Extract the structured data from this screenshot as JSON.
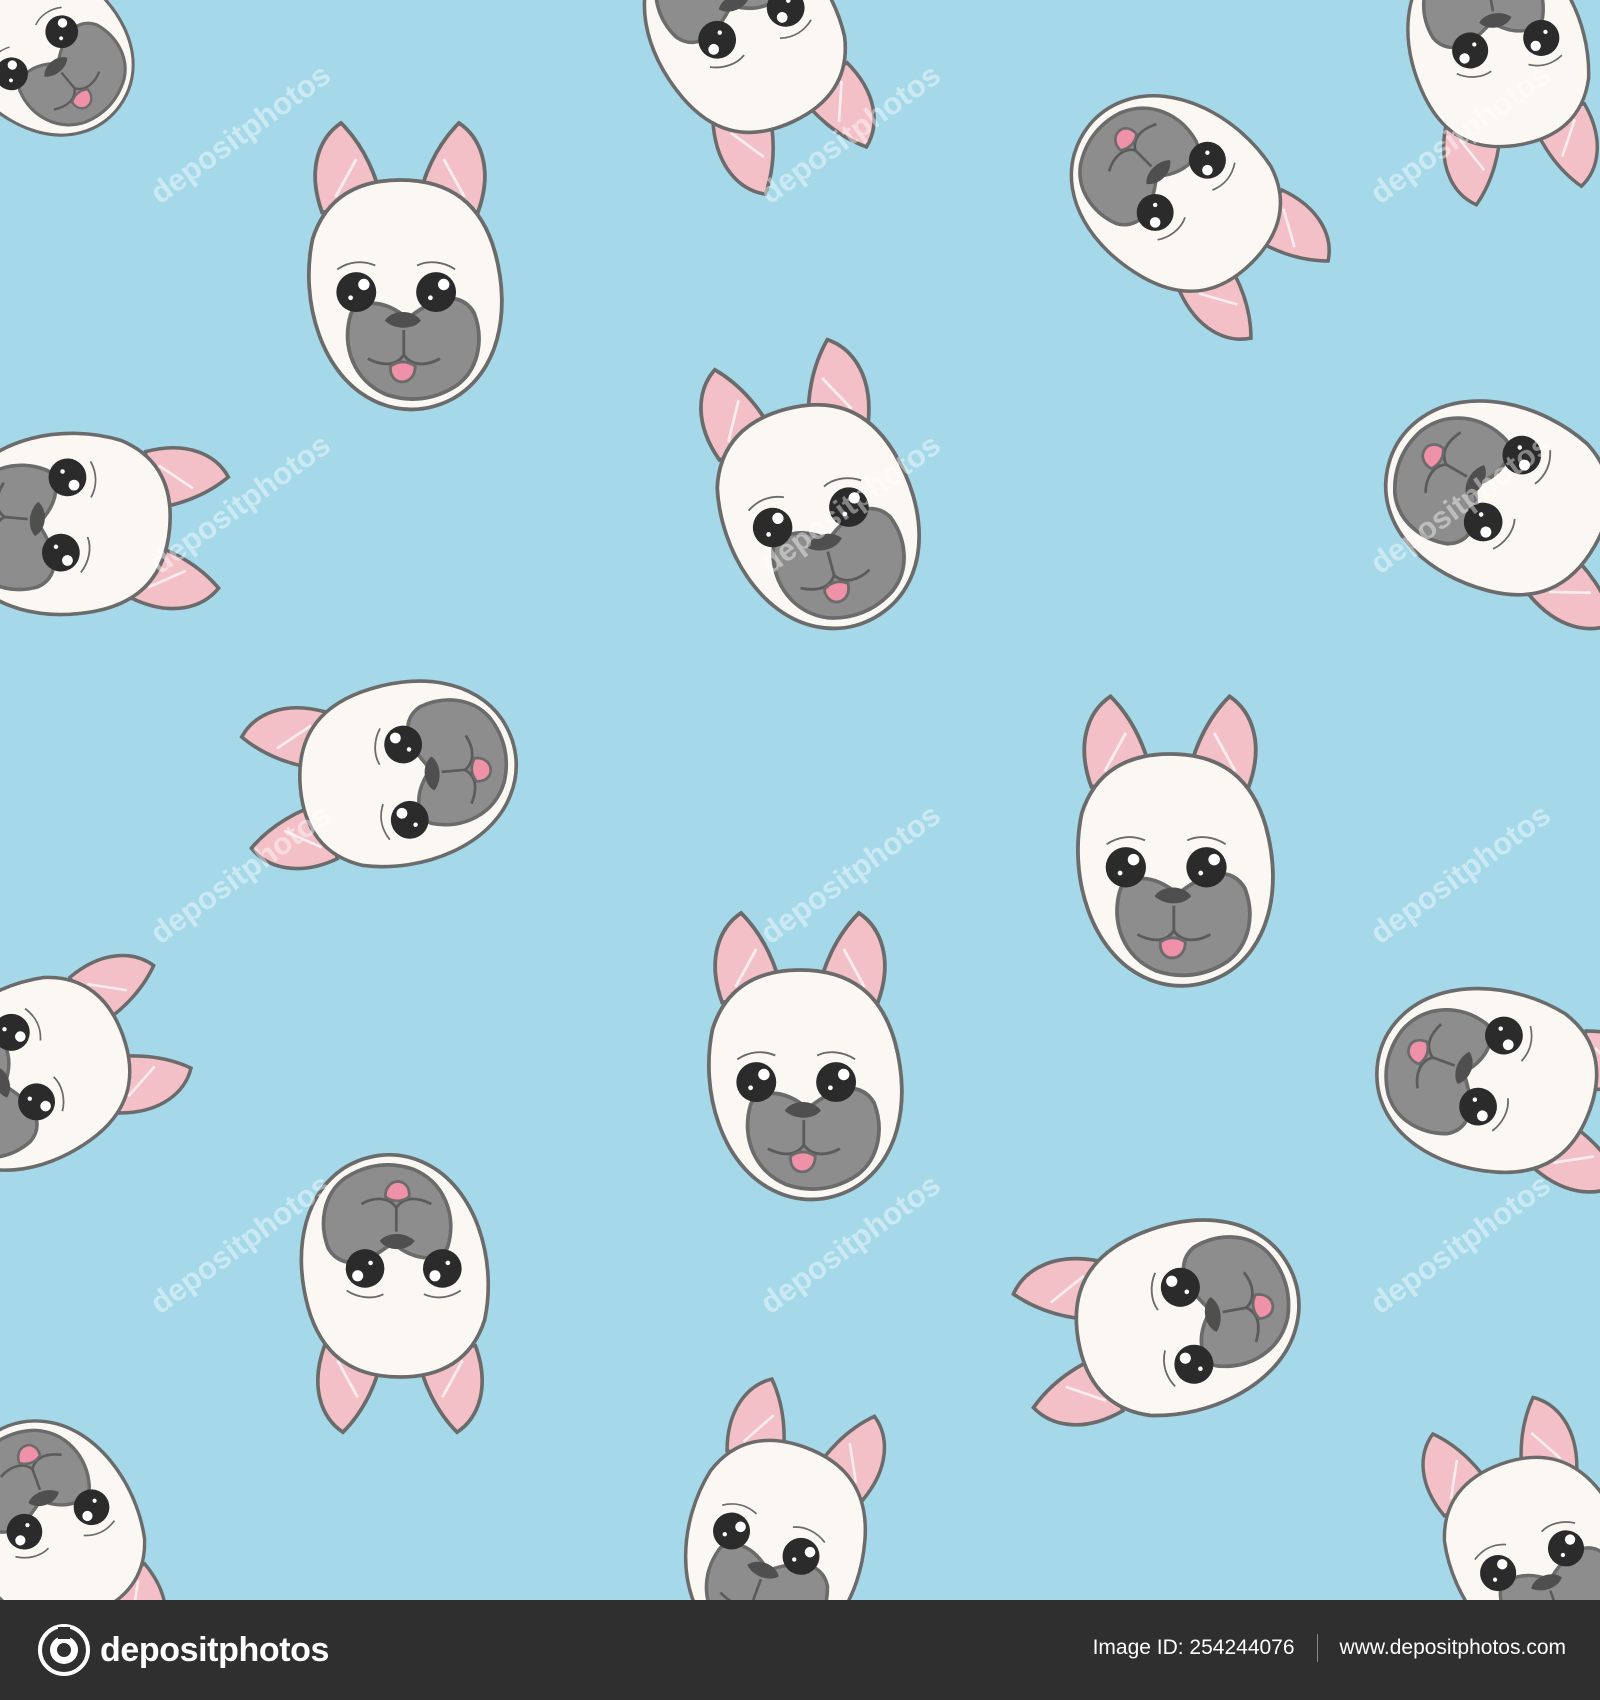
{
  "colors": {
    "background": "#a5d9e9",
    "footer": "#2f2f2f",
    "head": "#fbf7f3",
    "outline": "#6b6b6b",
    "muzzle": "#8d8d8d",
    "ear": "#f3c0c8",
    "tongue": "#ef91a8"
  },
  "footer": {
    "brand": "depositphotos",
    "image_id": "Image ID: 254244076",
    "site": "www.depositphotos.com"
  },
  "watermark": {
    "text": "depositphotos"
  },
  "icons": {
    "brand": "depositphotos-logo-icon",
    "pattern": "french-bulldog-head-icon"
  }
}
